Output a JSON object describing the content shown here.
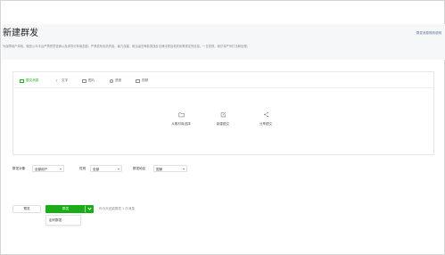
{
  "header": {
    "title": "新建群发",
    "link_label": "群发消息规则说明",
    "notice": "为保障用户体验，微信公众平台严禁恶意营销以及诱导分享朋友圈，严禁发布色情低俗、暴力血腥、政治谣言等各类违反法律法规及相关政策规定的信息。一旦发现，我们将严厉打击和处理。"
  },
  "editor": {
    "tabs": [
      {
        "label": "图文消息",
        "icon": "article-icon",
        "active": true
      },
      {
        "label": "文字",
        "icon": "text-icon",
        "active": false
      },
      {
        "label": "图片",
        "icon": "image-icon",
        "active": false
      },
      {
        "label": "语音",
        "icon": "voice-icon",
        "active": false
      },
      {
        "label": "视频",
        "icon": "video-icon",
        "active": false
      }
    ],
    "sources": [
      {
        "label": "从素材库选择",
        "icon": "folder-icon"
      },
      {
        "label": "新建图文",
        "icon": "edit-icon"
      },
      {
        "label": "分享图文",
        "icon": "share-icon"
      }
    ]
  },
  "filters": {
    "target_label": "群发对象",
    "target_value": "全部用户",
    "gender_label": "性别",
    "gender_value": "全部",
    "region_label": "群发地区",
    "region_value": "国家"
  },
  "actions": {
    "preview_label": "预览",
    "send_label": "群发",
    "quota_text": "你今天还能群发 1 次消息",
    "menu_item": "定时群发"
  },
  "colors": {
    "accent": "#1aad19",
    "link": "#576b95",
    "header_band": "#f6f7f9"
  }
}
